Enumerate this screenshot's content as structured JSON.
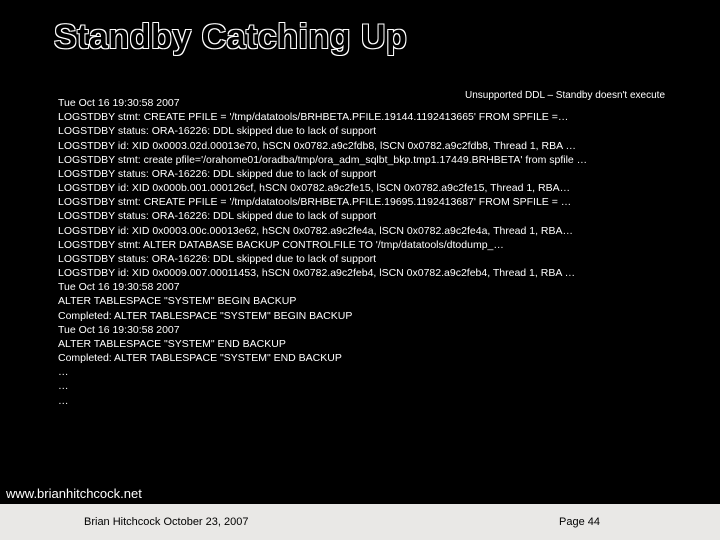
{
  "title": "Standby Catching Up",
  "note": "Unsupported DDL – Standby doesn't execute",
  "log": [
    "Tue Oct 16 19:30:58 2007",
    "LOGSTDBY stmt: CREATE PFILE = '/tmp/datatools/BRHBETA.PFILE.19144.1192413665' FROM SPFILE =…",
    "LOGSTDBY status: ORA-16226: DDL skipped due to lack of support",
    "LOGSTDBY id: XID 0x0003.02d.00013e70, hSCN 0x0782.a9c2fdb8, lSCN 0x0782.a9c2fdb8, Thread 1, RBA …",
    "LOGSTDBY stmt: create pfile='/orahome01/oradba/tmp/ora_adm_sqlbt_bkp.tmp1.17449.BRHBETA' from spfile …",
    "LOGSTDBY status: ORA-16226: DDL skipped due to lack of support",
    "LOGSTDBY id: XID 0x000b.001.000126cf, hSCN 0x0782.a9c2fe15, lSCN 0x0782.a9c2fe15, Thread 1, RBA…",
    "LOGSTDBY stmt: CREATE PFILE = '/tmp/datatools/BRHBETA.PFILE.19695.1192413687' FROM SPFILE = …",
    "LOGSTDBY status: ORA-16226: DDL skipped due to lack of support",
    "LOGSTDBY id: XID 0x0003.00c.00013e62, hSCN 0x0782.a9c2fe4a, lSCN 0x0782.a9c2fe4a, Thread 1, RBA…",
    "LOGSTDBY stmt: ALTER DATABASE BACKUP CONTROLFILE TO '/tmp/datatools/dtodump_…",
    "LOGSTDBY status: ORA-16226: DDL skipped due to lack of support",
    "LOGSTDBY id: XID 0x0009.007.00011453, hSCN 0x0782.a9c2feb4, lSCN 0x0782.a9c2feb4, Thread 1, RBA …",
    "Tue Oct 16 19:30:58 2007",
    "ALTER TABLESPACE \"SYSTEM\" BEGIN BACKUP",
    "Completed: ALTER TABLESPACE \"SYSTEM\" BEGIN BACKUP",
    "Tue Oct 16 19:30:58 2007",
    "ALTER TABLESPACE \"SYSTEM\" END BACKUP",
    "Completed: ALTER TABLESPACE \"SYSTEM\" END BACKUP",
    "…",
    "…",
    "…"
  ],
  "url": "www.brianhitchcock.net",
  "footer": {
    "author": "Brian Hitchcock  October 23, 2007",
    "page": "Page 44"
  }
}
